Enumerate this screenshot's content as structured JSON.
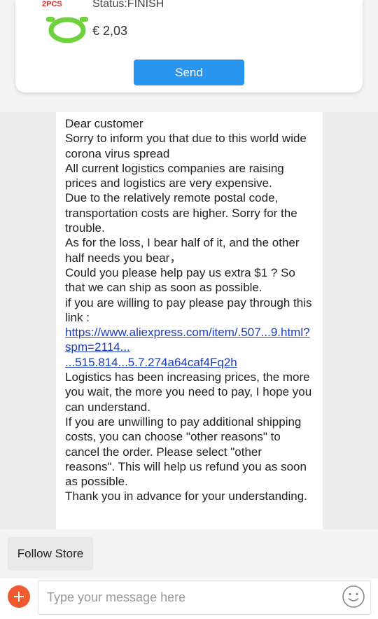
{
  "order": {
    "thumb_badge": "2PCS",
    "status": "Status:FINISH",
    "price": "€ 2,03",
    "send_label": "Send"
  },
  "message": {
    "text_before_link": "Dear customer\nSorry to inform you that due to this world wide corona virus spread\nAll current logistics companies are raising prices and logistics are very expensive.\nDue to the relatively remote postal code, transportation costs are higher. Sorry for the trouble.\nAs for the loss, I bear half of it, and the other half needs you bear，\nCould you please help pay us extra $1 ? So that we can ship as soon as possible.\nif you are willing to pay please pay through this link :",
    "link": "https://www.aliexpress.com/item/.507...9.html?spm=2114...\n...515.814...5.7.274a64caf4Fq2h",
    "text_after_link": "Logistics has been increasing prices, the more you wait, the more you need to pay, I hope you can understand.\nIf you are unwilling to pay additional shipping costs, you can choose \"other reasons\" to cancel the order. Please select \"other reasons\". This will help us refund you as soon as possible.\nThank you in advance for your understanding."
  },
  "follow_store_label": "Follow Store",
  "composer": {
    "placeholder": "Type your message here",
    "plus_icon": "plus-icon",
    "emoji_icon": "smiley-icon",
    "accent_color": "#f05a30",
    "send_color": "#2a95ef"
  }
}
